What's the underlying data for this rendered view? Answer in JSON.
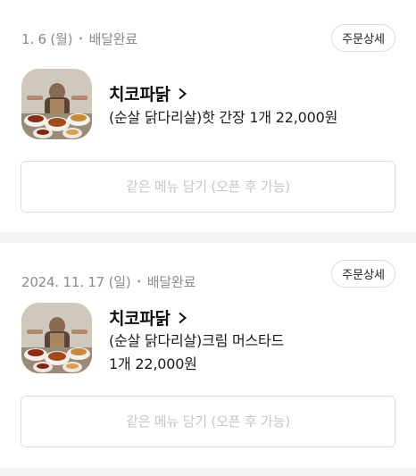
{
  "orders": [
    {
      "date": "1. 6 (월)",
      "separator": "•",
      "status": "배달완료",
      "detail_label": "주문상세",
      "store_name": "치코파닭",
      "item_line1": "(순살 닭다리살)핫 간장 1개 22,000원",
      "item_line2": "",
      "reorder_label": "같은 메뉴 담기 (오픈 후 가능)"
    },
    {
      "date": "2024. 11. 17 (일)",
      "separator": "•",
      "status": "배달완료",
      "detail_label": "주문상세",
      "store_name": "치코파닭",
      "item_line1": "(순살 닭다리살)크림 머스타드",
      "item_line2": "1개 22,000원",
      "reorder_label": "같은 메뉴 담기 (오픈 후 가능)"
    }
  ]
}
